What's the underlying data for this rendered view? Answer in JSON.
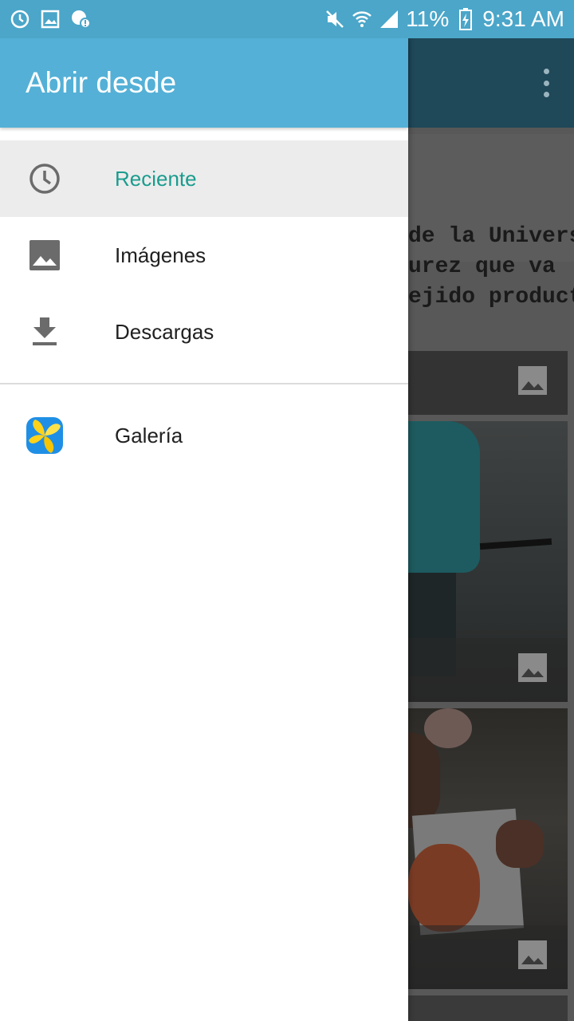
{
  "status_bar": {
    "battery": "11%",
    "time": "9:31 AM",
    "icons": [
      "sync-icon",
      "image-notification-icon",
      "chat-alert-icon",
      "mute-icon",
      "wifi-icon",
      "signal-icon",
      "battery-charging-icon"
    ]
  },
  "drawer": {
    "title": "Abrir desde",
    "items": [
      {
        "label": "Reciente",
        "icon": "clock-icon",
        "active": true
      },
      {
        "label": "Imágenes",
        "icon": "image-icon",
        "active": false
      },
      {
        "label": "Descargas",
        "icon": "download-icon",
        "active": false
      }
    ],
    "apps": [
      {
        "label": "Galería",
        "icon": "gallery-app-icon"
      }
    ]
  },
  "background_app": {
    "document_text": [
      "de la Univers",
      "urez que va",
      "ejido product"
    ],
    "overflow_menu_icon": "more-vert-icon"
  },
  "colors": {
    "header": "#54b0d6",
    "status_bar": "#4ba6c9",
    "active_text": "#1a9c8e",
    "active_bg": "#ececec"
  }
}
